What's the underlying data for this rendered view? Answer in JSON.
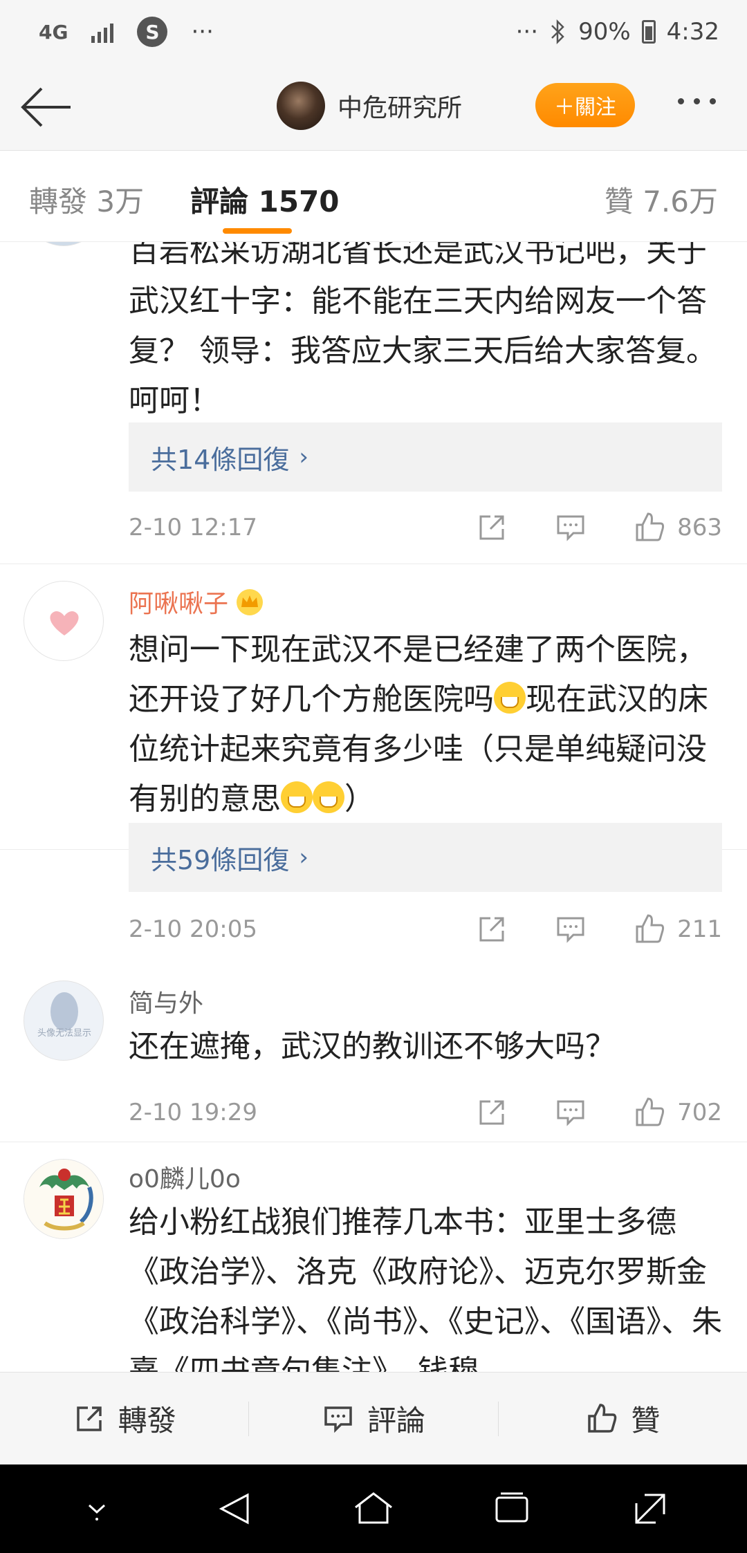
{
  "status_bar": {
    "network": "4G",
    "app_icon": "S",
    "more_left": "···",
    "more_right": "···",
    "battery": "90%",
    "time": "4:32"
  },
  "header": {
    "author_name": "中危研究所",
    "follow_label": "＋關注"
  },
  "tabs": {
    "repost": "轉發 3万",
    "comment": "評論 1570",
    "like": "贊 7.6万"
  },
  "comments": [
    {
      "text": "百岩松采访湖北省长还是武汉书记吧，关于武汉红十字：能不能在三天内给网友一个答复？ 领导：我答应大家三天后给大家答复。呵呵！",
      "replies": "共14條回復",
      "time": "2-10 12:17",
      "likes": "863"
    },
    {
      "name": "阿啾啾子",
      "text_a": "想问一下现在武汉不是已经建了两个医院，还开设了好几个方舱医院吗",
      "text_b": "现在武汉的床位统计起来究竟有多少哇（只是单纯疑问没有别的意思",
      "text_c": "）",
      "replies": "共59條回復",
      "time": "2-10 20:05",
      "likes": "211"
    },
    {
      "name": "简与外",
      "avatar_text": "头像无法显示",
      "text": "还在遮掩，武汉的教训还不够大吗？",
      "time": "2-10 19:29",
      "likes": "702"
    },
    {
      "name": "o0麟儿0o",
      "text": "给小粉红战狼们推荐几本书：亚里士多德《政治学》、洛克《政府论》、迈克尔罗斯金《政治科学》、《尚书》、《史记》、《国语》、朱熹《四书章句集注》、钱穆"
    }
  ],
  "bottom_bar": {
    "repost": "轉發",
    "comment": "評論",
    "like": "贊"
  },
  "colors": {
    "accent": "#ff8a00",
    "link": "#4a6d9c",
    "vip_name": "#eb7350"
  }
}
